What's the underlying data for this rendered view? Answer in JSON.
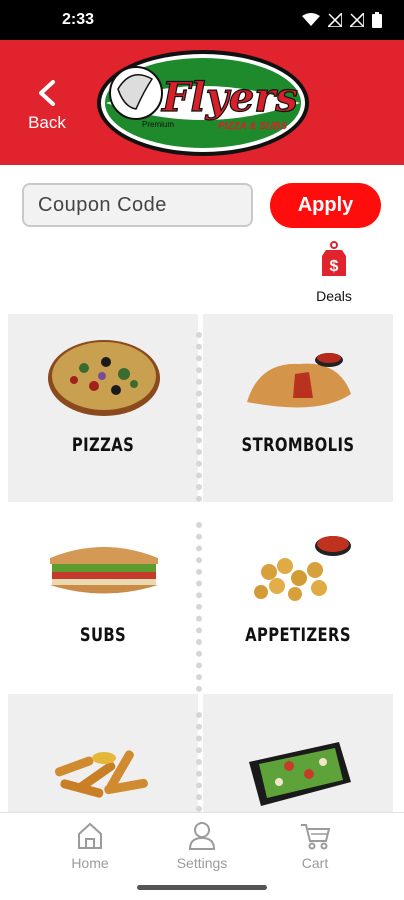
{
  "status": {
    "time": "2:33"
  },
  "header": {
    "back_label": "Back",
    "logo_text": "Flyers",
    "logo_premium": "Premium",
    "logo_sub": "PIZZA & SUBS"
  },
  "coupon": {
    "placeholder": "Coupon Code",
    "value": "",
    "apply_label": "Apply"
  },
  "deals": {
    "label": "Deals",
    "symbol": "$"
  },
  "menu": {
    "items": [
      {
        "label": "PIZZAS",
        "icon": "pizza-image"
      },
      {
        "label": "STROMBOLIS",
        "icon": "stromboli-image"
      },
      {
        "label": "SUBS",
        "icon": "sub-image"
      },
      {
        "label": "APPETIZERS",
        "icon": "appetizers-image"
      },
      {
        "label": "",
        "icon": "sticks-image"
      },
      {
        "label": "",
        "icon": "salad-image"
      }
    ]
  },
  "nav": {
    "home": "Home",
    "settings": "Settings",
    "cart": "Cart"
  },
  "colors": {
    "brand_red": "#e0232d",
    "apply_red": "#ff0d0d"
  }
}
